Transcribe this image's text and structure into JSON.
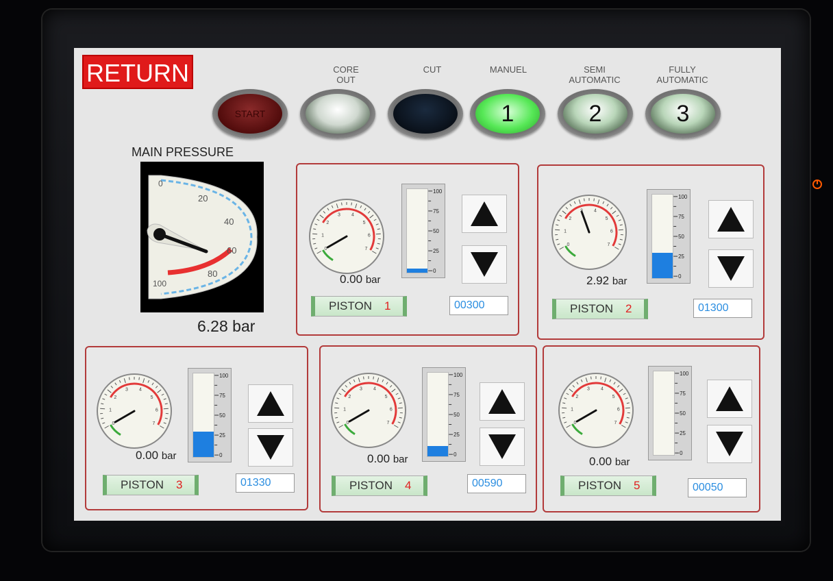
{
  "header": {
    "return_label": "RETURN",
    "modes": [
      {
        "label_line1": "",
        "label_line2": "",
        "button_text": "START",
        "button_color": "#6a0d0d"
      },
      {
        "label_line1": "CORE",
        "label_line2": "OUT",
        "button_text": "",
        "button_color": "#cfd8cf"
      },
      {
        "label_line1": "",
        "label_line2": "CUT",
        "button_text": "",
        "button_color": "#0e1826"
      },
      {
        "label_line1": "",
        "label_line2": "MANUEL",
        "button_text": "1",
        "button_color": "#7af07a"
      },
      {
        "label_line1": "SEMI",
        "label_line2": "AUTOMATIC",
        "button_text": "2",
        "button_color": "#b9d6b9"
      },
      {
        "label_line1": "FULLY",
        "label_line2": "AUTOMATIC",
        "button_text": "3",
        "button_color": "#b9d6b9"
      }
    ]
  },
  "main_pressure": {
    "title": "MAIN PRESSURE",
    "ticks": [
      "0",
      "20",
      "40",
      "60",
      "80",
      "100"
    ],
    "value": "6.28",
    "unit": "bar"
  },
  "bar_scale": [
    "100",
    "75",
    "50",
    "25",
    "0"
  ],
  "dial_ticks": [
    "0",
    "1",
    "2",
    "3",
    "4",
    "5",
    "6",
    "7"
  ],
  "pistons": [
    {
      "name": "PISTON",
      "number": "1",
      "value": "0.00",
      "unit": "bar",
      "count": "00300",
      "level_percent": 5
    },
    {
      "name": "PISTON",
      "number": "2",
      "value": "2.92",
      "unit": "bar",
      "count": "01300",
      "level_percent": 30
    },
    {
      "name": "PISTON",
      "number": "3",
      "value": "0.00",
      "unit": "bar",
      "count": "01330",
      "level_percent": 30
    },
    {
      "name": "PISTON",
      "number": "4",
      "value": "0.00",
      "unit": "bar",
      "count": "00590",
      "level_percent": 12
    },
    {
      "name": "PISTON",
      "number": "5",
      "value": "0.00",
      "unit": "bar",
      "count": "00050",
      "level_percent": 0
    }
  ],
  "colors": {
    "accent_red": "#e01a1a",
    "level_blue": "#1e7fe0",
    "count_blue": "#2a8de0",
    "frame_red": "#b23a3a"
  }
}
